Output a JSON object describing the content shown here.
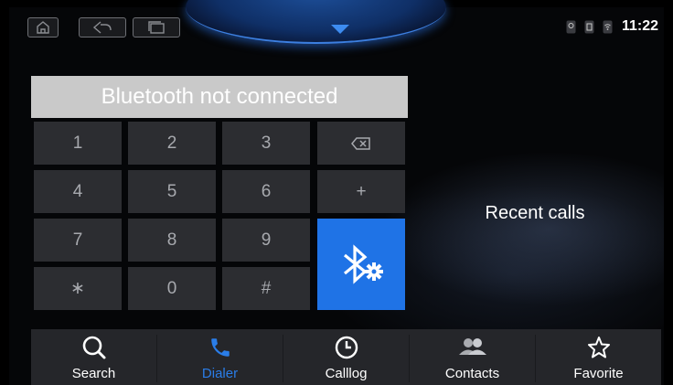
{
  "statusbar": {
    "nav_buttons": [
      "home-icon",
      "back-icon",
      "recent-apps-icon"
    ],
    "status_icons": [
      "location-icon",
      "sim-icon",
      "wifi-icon"
    ],
    "time": "11:22"
  },
  "dialer": {
    "banner": "Bluetooth not connected",
    "keys": [
      {
        "label": "1"
      },
      {
        "label": "2"
      },
      {
        "label": "3"
      },
      {
        "label": "",
        "icon": "backspace-icon"
      },
      {
        "label": "4"
      },
      {
        "label": "5"
      },
      {
        "label": "6"
      },
      {
        "label": "+"
      },
      {
        "label": "7"
      },
      {
        "label": "8"
      },
      {
        "label": "9"
      },
      {
        "label": "∗"
      },
      {
        "label": "0"
      },
      {
        "label": "#"
      }
    ],
    "bluetooth_settings_icon": "bluetooth-settings-icon"
  },
  "recent": {
    "title": "Recent calls"
  },
  "tabs": [
    {
      "label": "Search",
      "icon": "search-icon",
      "active": false
    },
    {
      "label": "Dialer",
      "icon": "phone-icon",
      "active": true
    },
    {
      "label": "Calllog",
      "icon": "clock-icon",
      "active": false
    },
    {
      "label": "Contacts",
      "icon": "contacts-icon",
      "active": false
    },
    {
      "label": "Favorite",
      "icon": "star-icon",
      "active": false
    }
  ],
  "colors": {
    "accent": "#1f73e6",
    "active_tab": "#2a7de8",
    "key_bg": "#2c2d31",
    "banner_bg": "#c9c9c9"
  }
}
